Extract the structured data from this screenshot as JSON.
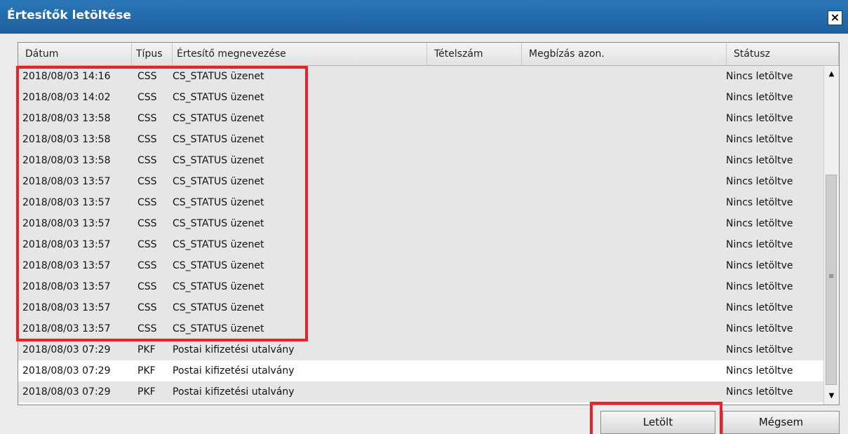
{
  "window": {
    "title": "Értesítők letöltése",
    "close_label": "×"
  },
  "columns": [
    "Dátum",
    "Típus",
    "Értesítő megnevezése",
    "Tételszám",
    "Megbízás azon.",
    "Státusz"
  ],
  "rows": [
    {
      "date": "2018/08/03 14:16",
      "type": "CSS",
      "name": "CS_STATUS üzenet",
      "item": "",
      "order": "",
      "status": "Nincs letöltve"
    },
    {
      "date": "2018/08/03 14:02",
      "type": "CSS",
      "name": "CS_STATUS üzenet",
      "item": "",
      "order": "",
      "status": "Nincs letöltve"
    },
    {
      "date": "2018/08/03 13:58",
      "type": "CSS",
      "name": "CS_STATUS üzenet",
      "item": "",
      "order": "",
      "status": "Nincs letöltve"
    },
    {
      "date": "2018/08/03 13:58",
      "type": "CSS",
      "name": "CS_STATUS üzenet",
      "item": "",
      "order": "",
      "status": "Nincs letöltve"
    },
    {
      "date": "2018/08/03 13:58",
      "type": "CSS",
      "name": "CS_STATUS üzenet",
      "item": "",
      "order": "",
      "status": "Nincs letöltve"
    },
    {
      "date": "2018/08/03 13:57",
      "type": "CSS",
      "name": "CS_STATUS üzenet",
      "item": "",
      "order": "",
      "status": "Nincs letöltve"
    },
    {
      "date": "2018/08/03 13:57",
      "type": "CSS",
      "name": "CS_STATUS üzenet",
      "item": "",
      "order": "",
      "status": "Nincs letöltve"
    },
    {
      "date": "2018/08/03 13:57",
      "type": "CSS",
      "name": "CS_STATUS üzenet",
      "item": "",
      "order": "",
      "status": "Nincs letöltve"
    },
    {
      "date": "2018/08/03 13:57",
      "type": "CSS",
      "name": "CS_STATUS üzenet",
      "item": "",
      "order": "",
      "status": "Nincs letöltve"
    },
    {
      "date": "2018/08/03 13:57",
      "type": "CSS",
      "name": "CS_STATUS üzenet",
      "item": "",
      "order": "",
      "status": "Nincs letöltve"
    },
    {
      "date": "2018/08/03 13:57",
      "type": "CSS",
      "name": "CS_STATUS üzenet",
      "item": "",
      "order": "",
      "status": "Nincs letöltve"
    },
    {
      "date": "2018/08/03 13:57",
      "type": "CSS",
      "name": "CS_STATUS üzenet",
      "item": "",
      "order": "",
      "status": "Nincs letöltve"
    },
    {
      "date": "2018/08/03 13:57",
      "type": "CSS",
      "name": "CS_STATUS üzenet",
      "item": "",
      "order": "",
      "status": "Nincs letöltve"
    },
    {
      "date": "2018/08/03 07:29",
      "type": "PKF",
      "name": "Postai kifizetési utalvány",
      "item": "",
      "order": "",
      "status": "Nincs letöltve"
    },
    {
      "date": "2018/08/03 07:29",
      "type": "PKF",
      "name": "Postai kifizetési utalvány",
      "item": "",
      "order": "",
      "status": "Nincs letöltve"
    },
    {
      "date": "2018/08/03 07:29",
      "type": "PKF",
      "name": "Postai kifizetési utalvány",
      "item": "",
      "order": "",
      "status": "Nincs letöltve"
    }
  ],
  "buttons": {
    "download": "Letölt",
    "cancel": "Mégsem"
  },
  "icons": {
    "close": "close-icon",
    "scroll_up": "scroll-up-arrow-icon",
    "scroll_down": "scroll-down-arrow-icon"
  },
  "colors": {
    "titlebar": "#1e5f9f",
    "highlight": "#e8212b"
  }
}
